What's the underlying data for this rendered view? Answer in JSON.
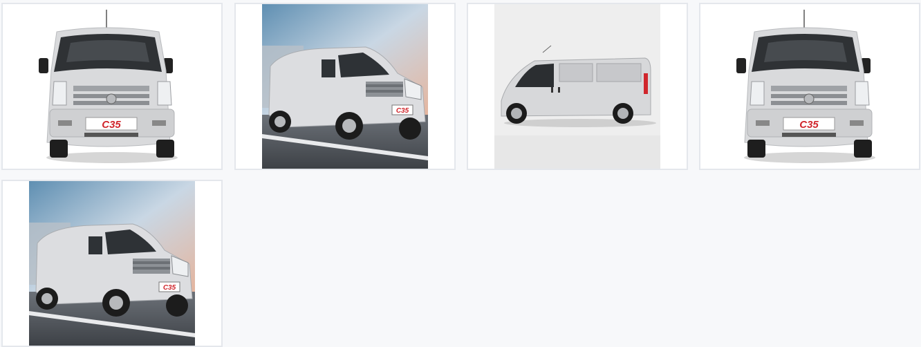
{
  "gallery": {
    "items": [
      {
        "view": "front",
        "plate": "C35"
      },
      {
        "view": "three-quarter-motion",
        "plate": "C35"
      },
      {
        "view": "side",
        "plate": ""
      },
      {
        "view": "front",
        "plate": "C35"
      },
      {
        "view": "three-quarter-motion",
        "plate": "C35"
      }
    ]
  },
  "colors": {
    "page_background": "#f7f8fa",
    "tile_border": "#e4e7ec",
    "van_body": "#d9dadc",
    "plate_red": "#d0262c"
  }
}
